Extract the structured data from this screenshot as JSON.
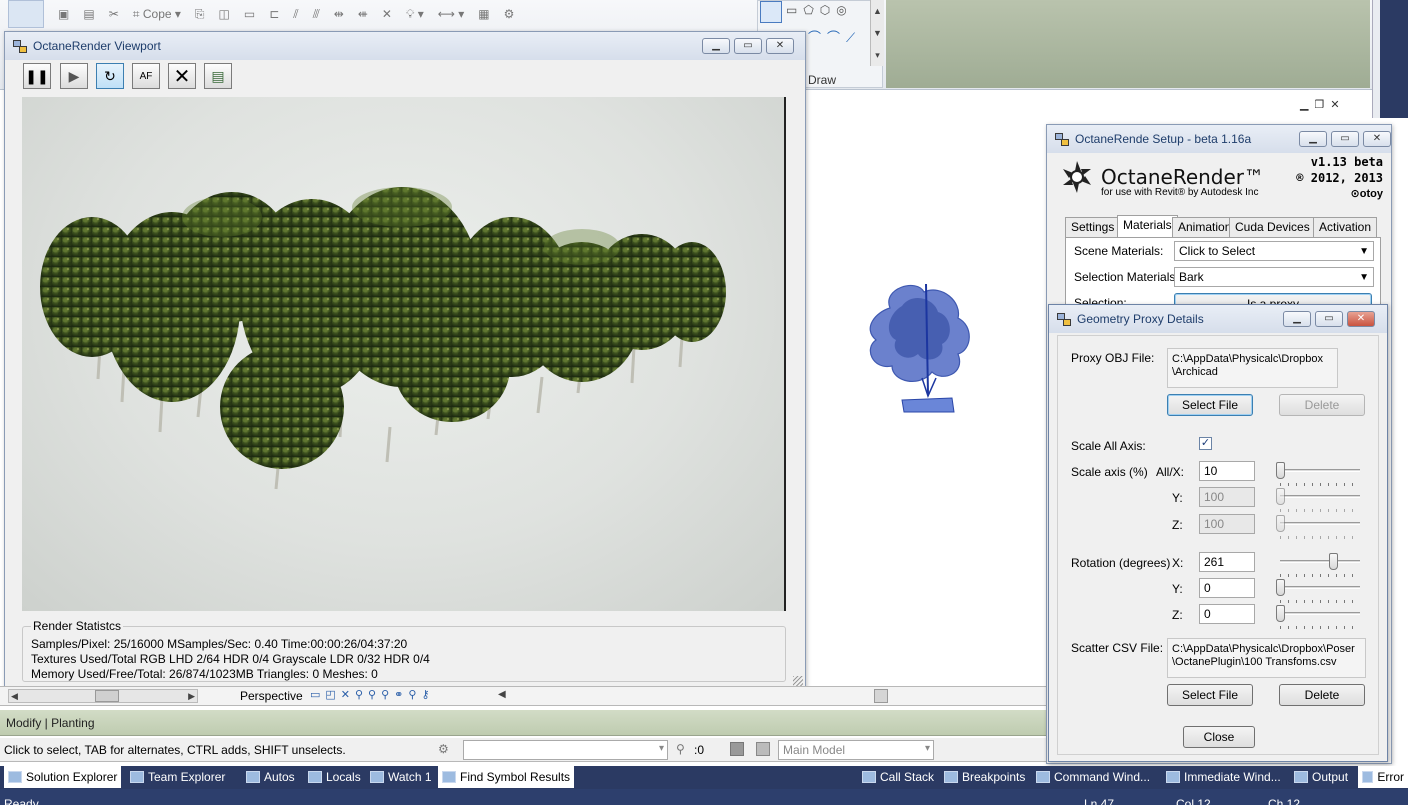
{
  "ribbon": {
    "copy_label": "Cope",
    "draw_label": "Draw"
  },
  "viewport": {
    "title": "OctaneRender Viewport",
    "stats": {
      "header": "Render Statistcs",
      "line1": "Samples/Pixel: 25/16000  MSamples/Sec: 0.40  Time:00:00:26/04:37:20",
      "line2": "Textures Used/Total RGB LHD 2/64  HDR 0/4  Grayscale LDR 0/32  HDR 0/4",
      "line3": "Memory Used/Free/Total: 26/874/1023MB  Triangles: 0  Meshes: 0"
    }
  },
  "view_bar": {
    "view_name": "Perspective"
  },
  "status": {
    "modify_label": "Modify | Planting",
    "hint": "Click to select, TAB for alternates, CTRL adds, SHIFT unselects.",
    "filter_count": ":0",
    "model": "Main Model"
  },
  "setup": {
    "title": "OctaneRende Setup - beta 1.16a",
    "brand": "OctaneRender™",
    "brand_sub": "for use with Revit® by Autodesk Inc",
    "version": "v1.13 beta",
    "copyright": "® 2012, 2013",
    "otoy": "otoy",
    "tabs": [
      "Settings",
      "Materials",
      "Animation",
      "Cuda Devices",
      "Activation"
    ],
    "scene_materials_label": "Scene Materials:",
    "scene_materials_value": "Click to Select",
    "selection_materials_label": "Selection Materials:",
    "selection_materials_value": "Bark",
    "selection_label": "Selection:",
    "selection_button": "Is a proxy"
  },
  "proxy": {
    "title": "Geometry Proxy Details",
    "obj_label": "Proxy OBJ File:",
    "obj_path_1": "C:\\AppData\\Physicalc\\Dropbox",
    "obj_path_2": "\\Archicad",
    "select_file": "Select File",
    "delete": "Delete",
    "scale_all_label": "Scale All Axis:",
    "scale_all_checked": true,
    "scale_axis_label": "Scale axis (%)",
    "all_x_label": "All/X:",
    "y_label": "Y:",
    "z_label": "Z:",
    "scale_x": "10",
    "scale_y": "100",
    "scale_z": "100",
    "rotation_label": "Rotation (degrees)",
    "x_label": "X:",
    "rot_x": "261",
    "rot_y": "0",
    "rot_z": "0",
    "scatter_label": "Scatter CSV File:",
    "scatter_path_1": "C:\\AppData\\Physicalc\\Dropbox\\Poser",
    "scatter_path_2": "\\OctanePlugin\\100 Transfoms.csv",
    "select_file_2": "Select File",
    "delete_2": "Delete",
    "close": "Close"
  },
  "taskbar": {
    "items": [
      "Solution Explorer",
      "Team Explorer",
      "Autos",
      "Locals",
      "Watch 1",
      "Find Symbol Results",
      "Call Stack",
      "Breakpoints",
      "Command Wind...",
      "Immediate Wind...",
      "Output",
      "Error"
    ]
  },
  "statusbar": {
    "ready": "Ready",
    "ln": "Ln 47",
    "col": "Col 12",
    "ch": "Ch 12"
  }
}
